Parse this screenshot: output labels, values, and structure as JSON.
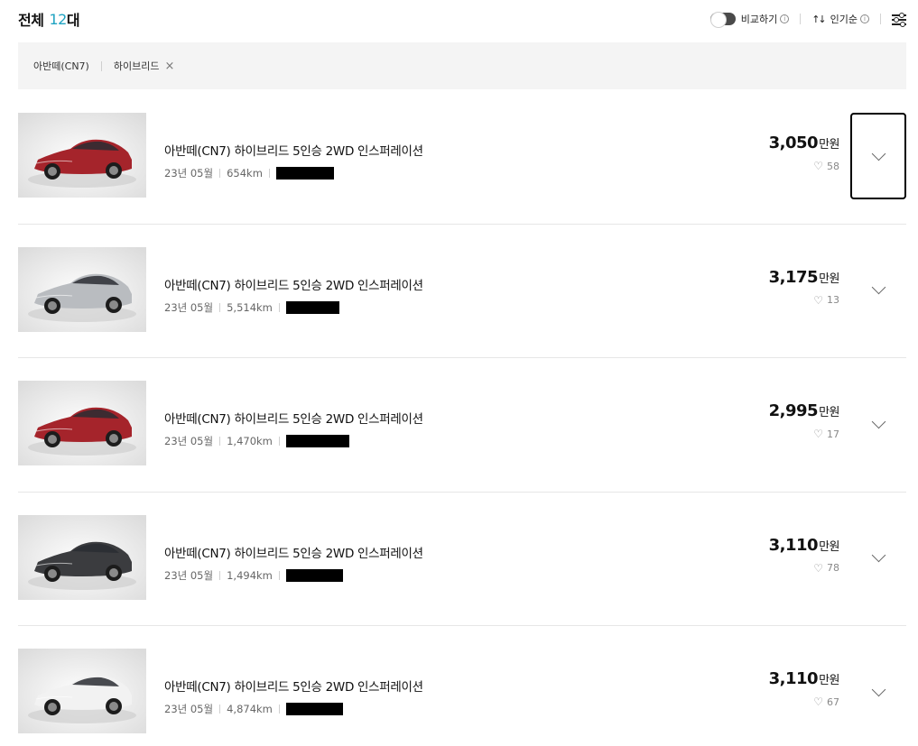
{
  "header": {
    "total_label": "전체",
    "total_count": "12",
    "total_unit": "대",
    "compare_label": "비교하기",
    "sort_label": "인기순",
    "info_glyph": "i",
    "sort_icon": "↑↓"
  },
  "filters": [
    {
      "label": "아반떼(CN7)",
      "removable": false
    },
    {
      "label": "하이브리드",
      "removable": true,
      "remove_glyph": "×"
    }
  ],
  "listings": [
    {
      "name": "아반떼(CN7) 하이브리드 5인승 2WD 인스퍼레이션",
      "date": "23년 05월",
      "mileage": "654km",
      "price": "3,050",
      "price_unit": "만원",
      "likes": "58",
      "car_color": "#a5242b",
      "focused": true
    },
    {
      "name": "아반떼(CN7) 하이브리드 5인승 2WD 인스퍼레이션",
      "date": "23년 05월",
      "mileage": "5,514km",
      "price": "3,175",
      "price_unit": "만원",
      "likes": "13",
      "car_color": "#b9bcc0",
      "focused": false
    },
    {
      "name": "아반떼(CN7) 하이브리드 5인승 2WD 인스퍼레이션",
      "date": "23년 05월",
      "mileage": "1,470km",
      "price": "2,995",
      "price_unit": "만원",
      "likes": "17",
      "car_color": "#a5242b",
      "focused": false
    },
    {
      "name": "아반떼(CN7) 하이브리드 5인승 2WD 인스퍼레이션",
      "date": "23년 05월",
      "mileage": "1,494km",
      "price": "3,110",
      "price_unit": "만원",
      "likes": "78",
      "car_color": "#3b3c3f",
      "focused": false
    },
    {
      "name": "아반떼(CN7) 하이브리드 5인승 2WD 인스퍼레이션",
      "date": "23년 05월",
      "mileage": "4,874km",
      "price": "3,110",
      "price_unit": "만원",
      "likes": "67",
      "car_color": "#f2f2f2",
      "focused": false
    }
  ],
  "colors": {
    "accent": "#1fa3c2",
    "redaction": "#000000"
  },
  "icons": {
    "heart": "heart-icon",
    "chevron": "chevron-down-icon",
    "filter": "filter-settings-icon",
    "close": "close-icon"
  }
}
